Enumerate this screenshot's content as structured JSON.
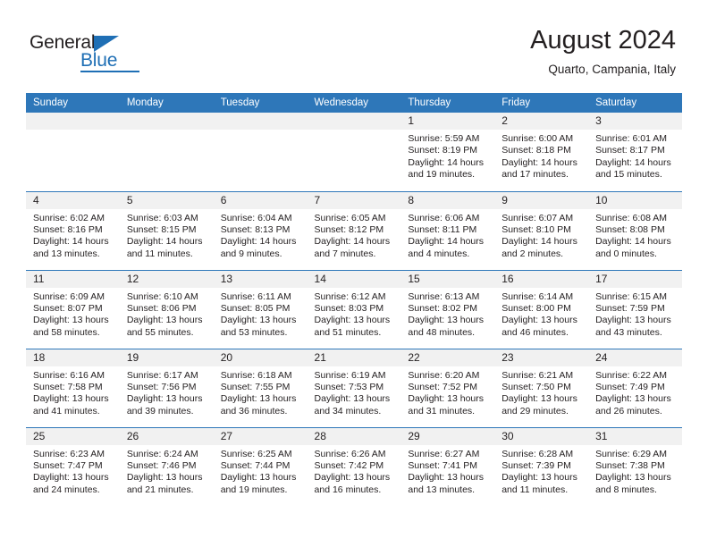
{
  "brand": {
    "name_top": "General",
    "name_bottom": "Blue"
  },
  "header": {
    "title": "August 2024",
    "subtitle": "Quarto, Campania, Italy",
    "accent_color": "#2e77b9",
    "daynum_band_color": "#f1f1f1"
  },
  "weekday_headers": [
    "Sunday",
    "Monday",
    "Tuesday",
    "Wednesday",
    "Thursday",
    "Friday",
    "Saturday"
  ],
  "labels": {
    "sunrise_prefix": "Sunrise:",
    "sunset_prefix": "Sunset:",
    "daylight_prefix": "Daylight:"
  },
  "weeks": [
    [
      {
        "day": "",
        "empty": true
      },
      {
        "day": "",
        "empty": true
      },
      {
        "day": "",
        "empty": true
      },
      {
        "day": "",
        "empty": true
      },
      {
        "day": "1",
        "sunrise": "Sunrise: 5:59 AM",
        "sunset": "Sunset: 8:19 PM",
        "daylight_line1": "Daylight: 14 hours",
        "daylight_line2": "and 19 minutes."
      },
      {
        "day": "2",
        "sunrise": "Sunrise: 6:00 AM",
        "sunset": "Sunset: 8:18 PM",
        "daylight_line1": "Daylight: 14 hours",
        "daylight_line2": "and 17 minutes."
      },
      {
        "day": "3",
        "sunrise": "Sunrise: 6:01 AM",
        "sunset": "Sunset: 8:17 PM",
        "daylight_line1": "Daylight: 14 hours",
        "daylight_line2": "and 15 minutes."
      }
    ],
    [
      {
        "day": "4",
        "sunrise": "Sunrise: 6:02 AM",
        "sunset": "Sunset: 8:16 PM",
        "daylight_line1": "Daylight: 14 hours",
        "daylight_line2": "and 13 minutes."
      },
      {
        "day": "5",
        "sunrise": "Sunrise: 6:03 AM",
        "sunset": "Sunset: 8:15 PM",
        "daylight_line1": "Daylight: 14 hours",
        "daylight_line2": "and 11 minutes."
      },
      {
        "day": "6",
        "sunrise": "Sunrise: 6:04 AM",
        "sunset": "Sunset: 8:13 PM",
        "daylight_line1": "Daylight: 14 hours",
        "daylight_line2": "and 9 minutes."
      },
      {
        "day": "7",
        "sunrise": "Sunrise: 6:05 AM",
        "sunset": "Sunset: 8:12 PM",
        "daylight_line1": "Daylight: 14 hours",
        "daylight_line2": "and 7 minutes."
      },
      {
        "day": "8",
        "sunrise": "Sunrise: 6:06 AM",
        "sunset": "Sunset: 8:11 PM",
        "daylight_line1": "Daylight: 14 hours",
        "daylight_line2": "and 4 minutes."
      },
      {
        "day": "9",
        "sunrise": "Sunrise: 6:07 AM",
        "sunset": "Sunset: 8:10 PM",
        "daylight_line1": "Daylight: 14 hours",
        "daylight_line2": "and 2 minutes."
      },
      {
        "day": "10",
        "sunrise": "Sunrise: 6:08 AM",
        "sunset": "Sunset: 8:08 PM",
        "daylight_line1": "Daylight: 14 hours",
        "daylight_line2": "and 0 minutes."
      }
    ],
    [
      {
        "day": "11",
        "sunrise": "Sunrise: 6:09 AM",
        "sunset": "Sunset: 8:07 PM",
        "daylight_line1": "Daylight: 13 hours",
        "daylight_line2": "and 58 minutes."
      },
      {
        "day": "12",
        "sunrise": "Sunrise: 6:10 AM",
        "sunset": "Sunset: 8:06 PM",
        "daylight_line1": "Daylight: 13 hours",
        "daylight_line2": "and 55 minutes."
      },
      {
        "day": "13",
        "sunrise": "Sunrise: 6:11 AM",
        "sunset": "Sunset: 8:05 PM",
        "daylight_line1": "Daylight: 13 hours",
        "daylight_line2": "and 53 minutes."
      },
      {
        "day": "14",
        "sunrise": "Sunrise: 6:12 AM",
        "sunset": "Sunset: 8:03 PM",
        "daylight_line1": "Daylight: 13 hours",
        "daylight_line2": "and 51 minutes."
      },
      {
        "day": "15",
        "sunrise": "Sunrise: 6:13 AM",
        "sunset": "Sunset: 8:02 PM",
        "daylight_line1": "Daylight: 13 hours",
        "daylight_line2": "and 48 minutes."
      },
      {
        "day": "16",
        "sunrise": "Sunrise: 6:14 AM",
        "sunset": "Sunset: 8:00 PM",
        "daylight_line1": "Daylight: 13 hours",
        "daylight_line2": "and 46 minutes."
      },
      {
        "day": "17",
        "sunrise": "Sunrise: 6:15 AM",
        "sunset": "Sunset: 7:59 PM",
        "daylight_line1": "Daylight: 13 hours",
        "daylight_line2": "and 43 minutes."
      }
    ],
    [
      {
        "day": "18",
        "sunrise": "Sunrise: 6:16 AM",
        "sunset": "Sunset: 7:58 PM",
        "daylight_line1": "Daylight: 13 hours",
        "daylight_line2": "and 41 minutes."
      },
      {
        "day": "19",
        "sunrise": "Sunrise: 6:17 AM",
        "sunset": "Sunset: 7:56 PM",
        "daylight_line1": "Daylight: 13 hours",
        "daylight_line2": "and 39 minutes."
      },
      {
        "day": "20",
        "sunrise": "Sunrise: 6:18 AM",
        "sunset": "Sunset: 7:55 PM",
        "daylight_line1": "Daylight: 13 hours",
        "daylight_line2": "and 36 minutes."
      },
      {
        "day": "21",
        "sunrise": "Sunrise: 6:19 AM",
        "sunset": "Sunset: 7:53 PM",
        "daylight_line1": "Daylight: 13 hours",
        "daylight_line2": "and 34 minutes."
      },
      {
        "day": "22",
        "sunrise": "Sunrise: 6:20 AM",
        "sunset": "Sunset: 7:52 PM",
        "daylight_line1": "Daylight: 13 hours",
        "daylight_line2": "and 31 minutes."
      },
      {
        "day": "23",
        "sunrise": "Sunrise: 6:21 AM",
        "sunset": "Sunset: 7:50 PM",
        "daylight_line1": "Daylight: 13 hours",
        "daylight_line2": "and 29 minutes."
      },
      {
        "day": "24",
        "sunrise": "Sunrise: 6:22 AM",
        "sunset": "Sunset: 7:49 PM",
        "daylight_line1": "Daylight: 13 hours",
        "daylight_line2": "and 26 minutes."
      }
    ],
    [
      {
        "day": "25",
        "sunrise": "Sunrise: 6:23 AM",
        "sunset": "Sunset: 7:47 PM",
        "daylight_line1": "Daylight: 13 hours",
        "daylight_line2": "and 24 minutes."
      },
      {
        "day": "26",
        "sunrise": "Sunrise: 6:24 AM",
        "sunset": "Sunset: 7:46 PM",
        "daylight_line1": "Daylight: 13 hours",
        "daylight_line2": "and 21 minutes."
      },
      {
        "day": "27",
        "sunrise": "Sunrise: 6:25 AM",
        "sunset": "Sunset: 7:44 PM",
        "daylight_line1": "Daylight: 13 hours",
        "daylight_line2": "and 19 minutes."
      },
      {
        "day": "28",
        "sunrise": "Sunrise: 6:26 AM",
        "sunset": "Sunset: 7:42 PM",
        "daylight_line1": "Daylight: 13 hours",
        "daylight_line2": "and 16 minutes."
      },
      {
        "day": "29",
        "sunrise": "Sunrise: 6:27 AM",
        "sunset": "Sunset: 7:41 PM",
        "daylight_line1": "Daylight: 13 hours",
        "daylight_line2": "and 13 minutes."
      },
      {
        "day": "30",
        "sunrise": "Sunrise: 6:28 AM",
        "sunset": "Sunset: 7:39 PM",
        "daylight_line1": "Daylight: 13 hours",
        "daylight_line2": "and 11 minutes."
      },
      {
        "day": "31",
        "sunrise": "Sunrise: 6:29 AM",
        "sunset": "Sunset: 7:38 PM",
        "daylight_line1": "Daylight: 13 hours",
        "daylight_line2": "and 8 minutes."
      }
    ]
  ]
}
